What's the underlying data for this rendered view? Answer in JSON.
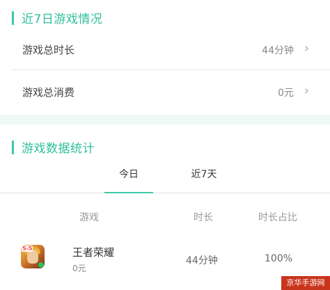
{
  "recent": {
    "title": "近7日游戏情况",
    "rows": [
      {
        "label": "游戏总时长",
        "value": "44分钟"
      },
      {
        "label": "游戏总消费",
        "value": "0元"
      }
    ]
  },
  "stats": {
    "title": "游戏数据统计",
    "tabs": [
      {
        "label": "今日",
        "selected": true
      },
      {
        "label": "近7天",
        "selected": false
      }
    ],
    "columns": [
      "游戏",
      "时长",
      "时长占比"
    ],
    "rows": [
      {
        "icon": "honor-of-kings-app-icon",
        "name": "王者荣耀",
        "cost": "0元",
        "duration": "44分钟",
        "ratio": "100%"
      }
    ]
  },
  "icons": {
    "chevron": "chevron-right-icon",
    "app_badge": "5-5"
  },
  "colors": {
    "accent": "#3cc9a8",
    "title": "#2fbf9a",
    "divider_bg": "#eef9f6",
    "watermark_bg": "#c9351c"
  },
  "watermark": "京华手游网"
}
